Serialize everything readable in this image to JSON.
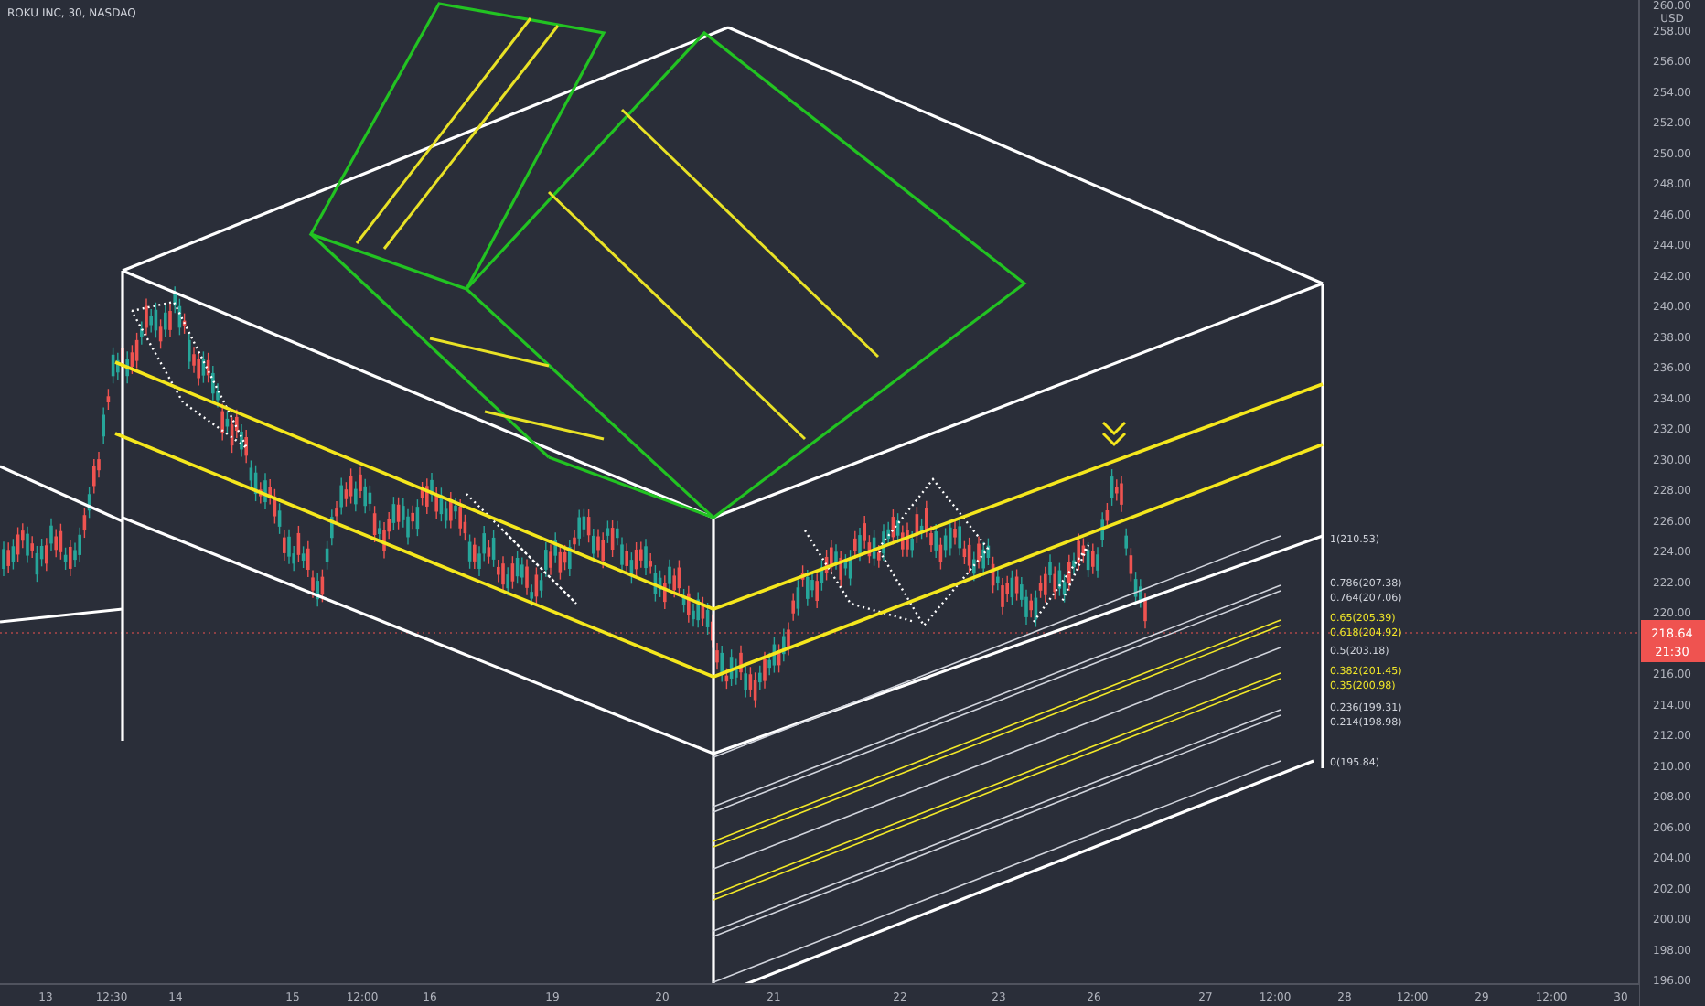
{
  "header": {
    "title": "ROKU INC, 30, NASDAQ"
  },
  "price_axis": {
    "top_label": "260.00",
    "unit": "USD",
    "labels": [
      "258.00",
      "256.00",
      "254.00",
      "252.00",
      "250.00",
      "248.00",
      "246.00",
      "244.00",
      "242.00",
      "240.00",
      "238.00",
      "236.00",
      "234.00",
      "232.00",
      "230.00",
      "228.00",
      "226.00",
      "224.00",
      "222.00",
      "220.00",
      "216.00",
      "214.00",
      "212.00",
      "210.00",
      "208.00",
      "206.00",
      "204.00",
      "202.00",
      "200.00",
      "198.00",
      "196.00"
    ],
    "last_price": "218.64",
    "countdown": "21:30"
  },
  "time_axis": {
    "labels": [
      "13",
      "12:30",
      "14",
      "15",
      "12:00",
      "16",
      "19",
      "20",
      "21",
      "22",
      "23",
      "26",
      "27",
      "12:00",
      "28",
      "12:00",
      "29",
      "12:00",
      "30"
    ]
  },
  "fib_levels": [
    {
      "label": "1(210.53)",
      "color": "#d1d4dc"
    },
    {
      "label": "0.786(207.38)",
      "color": "#d1d4dc"
    },
    {
      "label": "0.764(207.06)",
      "color": "#d1d4dc"
    },
    {
      "label": "0.65(205.39)",
      "color": "#f2e829"
    },
    {
      "label": "0.618(204.92)",
      "color": "#f2e829"
    },
    {
      "label": "0.5(203.18)",
      "color": "#d1d4dc"
    },
    {
      "label": "0.382(201.45)",
      "color": "#f2e829"
    },
    {
      "label": "0.35(200.98)",
      "color": "#f2e829"
    },
    {
      "label": "0.236(199.31)",
      "color": "#d1d4dc"
    },
    {
      "label": "0.214(198.98)",
      "color": "#d1d4dc"
    },
    {
      "label": "0(195.84)",
      "color": "#d1d4dc"
    }
  ]
}
